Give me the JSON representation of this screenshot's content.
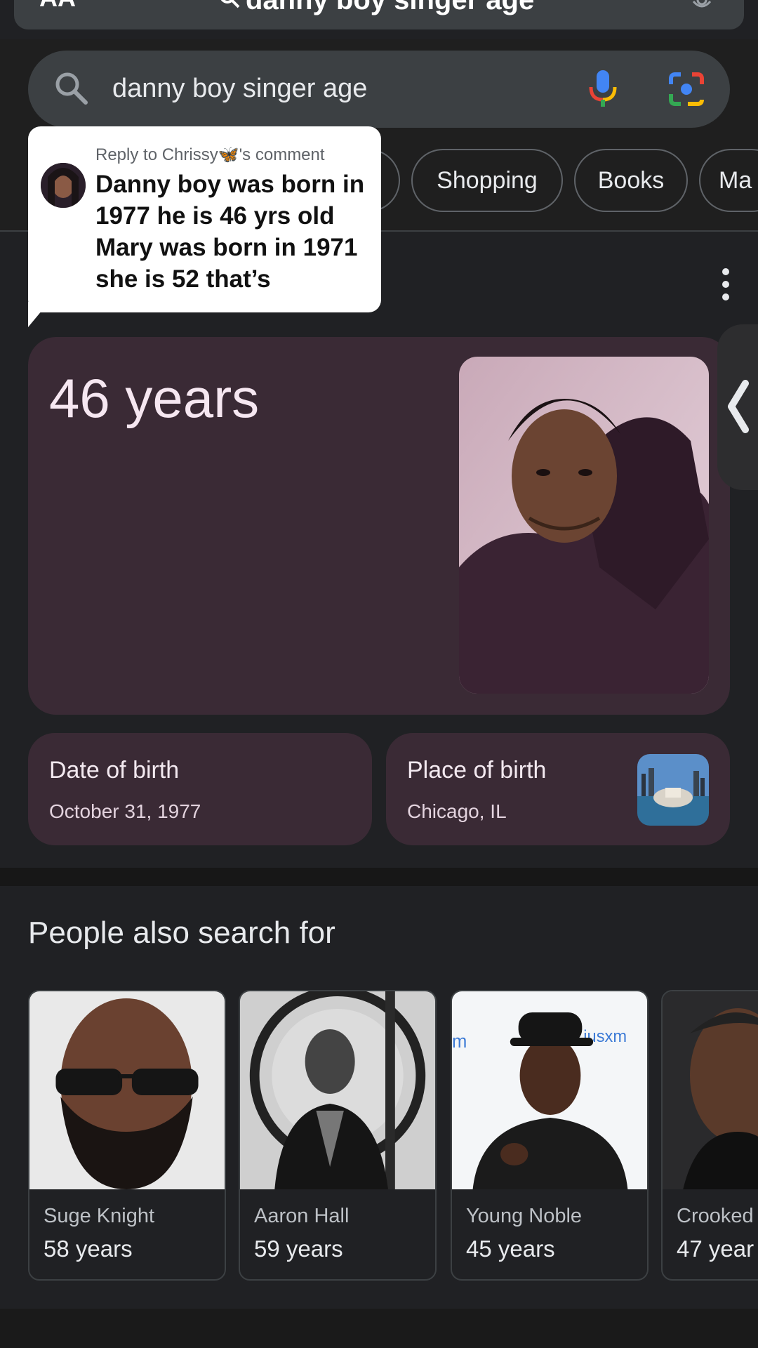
{
  "browser": {
    "aa_label": "AA",
    "url_text": "danny boy singer age"
  },
  "search": {
    "query": "danny boy singer age"
  },
  "chips": [
    {
      "label": ""
    },
    {
      "label": "Shopping"
    },
    {
      "label": "Books"
    },
    {
      "label": "Ma"
    }
  ],
  "comment": {
    "header": "Reply to Chrissy🦋's comment",
    "text": "Danny boy was born in 1977 he is 46 yrs old Mary was born in 1971 she is 52 that’s"
  },
  "knowledge": {
    "age": "46 years",
    "date_of_birth_label": "Date of birth",
    "date_of_birth": "October 31, 1977",
    "place_of_birth_label": "Place of birth",
    "place_of_birth": "Chicago, IL"
  },
  "people_also_search": {
    "title": "People also search for",
    "people": [
      {
        "name": "Suge Knight",
        "age": "58 years"
      },
      {
        "name": "Aaron Hall",
        "age": "59 years"
      },
      {
        "name": "Young Noble",
        "age": "45 years"
      },
      {
        "name": "Crooked",
        "age": "47 year"
      }
    ]
  },
  "colors": {
    "background": "#202124",
    "card": "#3a2a35",
    "search_box": "#3c4043"
  },
  "icons": [
    "search-icon",
    "microphone-icon",
    "lens-icon",
    "more-vert-icon",
    "chevron-left-icon"
  ]
}
